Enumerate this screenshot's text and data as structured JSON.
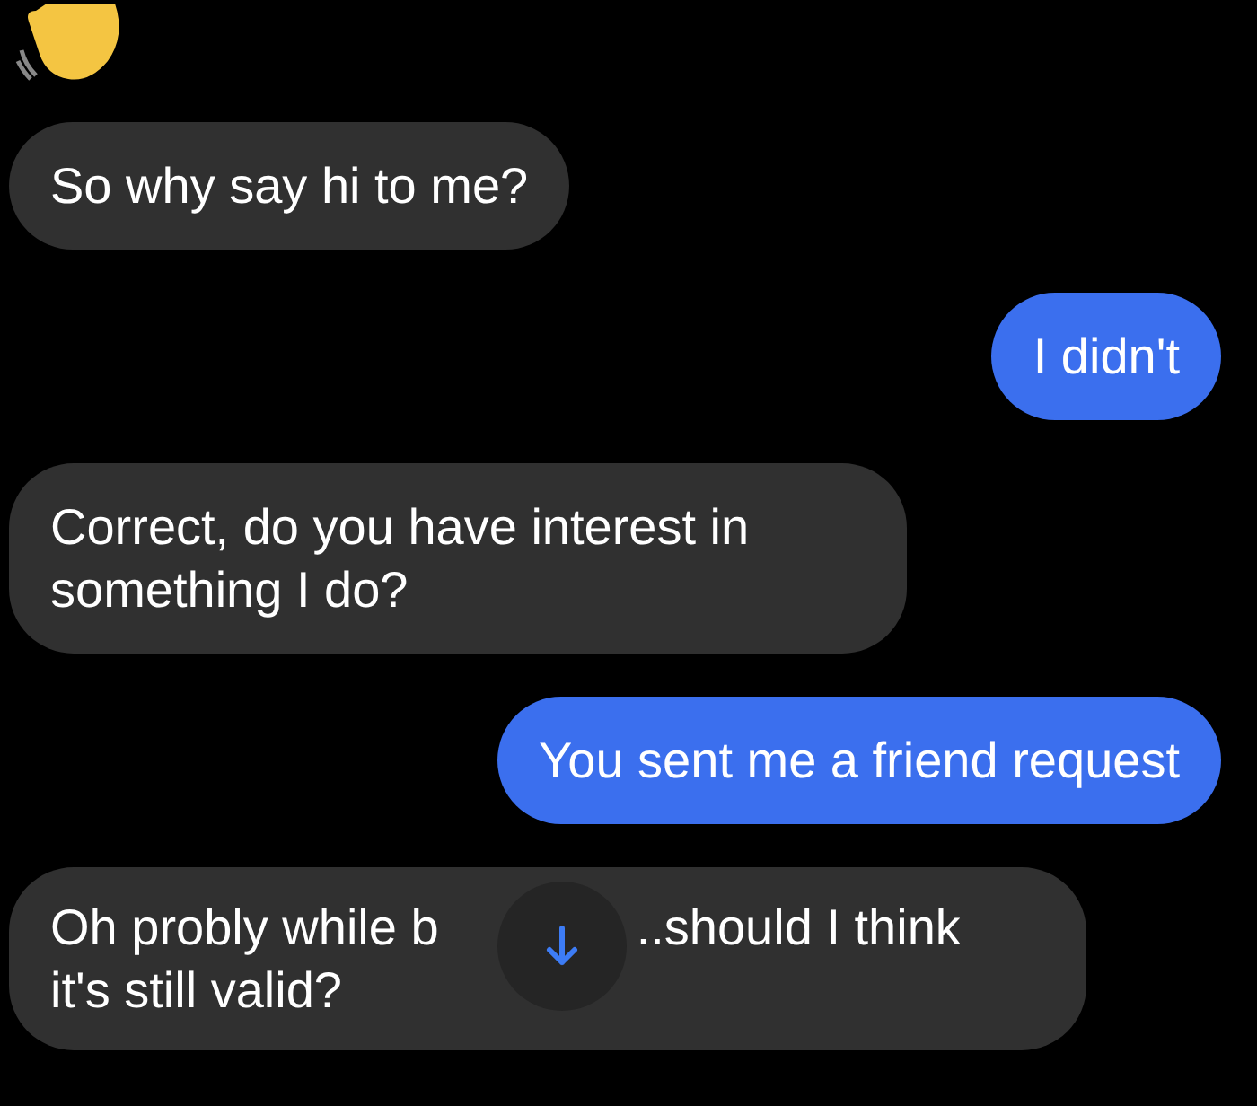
{
  "messages": [
    {
      "outgoing": false,
      "kind": "text",
      "text": "So why say hi to me?"
    },
    {
      "outgoing": true,
      "kind": "text",
      "text": "I didn't"
    },
    {
      "outgoing": false,
      "kind": "text",
      "text": "Correct, do you have interest in something I do?"
    },
    {
      "outgoing": true,
      "kind": "text",
      "text": "You sent me a friend request"
    },
    {
      "outgoing": false,
      "kind": "covered",
      "before": "Oh probly while b",
      "after": "..should I think",
      "rest": "it's still valid?"
    }
  ]
}
